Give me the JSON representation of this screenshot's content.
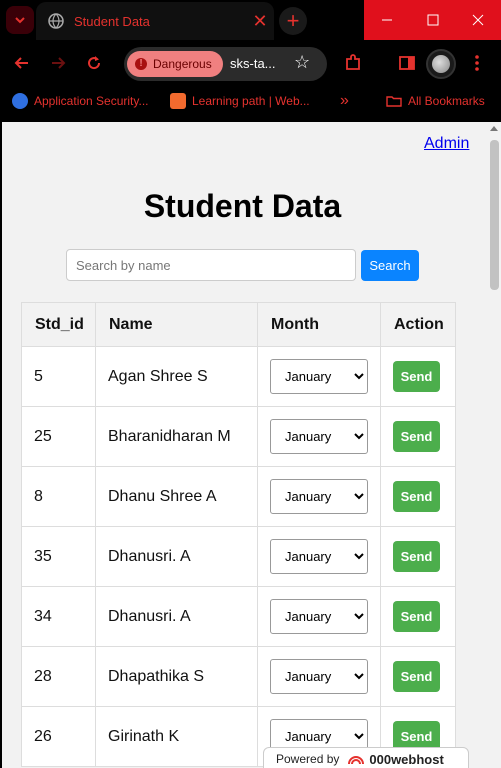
{
  "browser": {
    "tab_title": "Student Data",
    "security_label": "Dangerous",
    "url": "sks-ta...",
    "bookmarks": [
      {
        "label": "Application Security..."
      },
      {
        "label": "Learning path | Web..."
      },
      {
        "label": "All Bookmarks"
      }
    ],
    "overflow_label": "»",
    "colors": {
      "accent": "#e5322e",
      "window_controls": "#e0101c"
    }
  },
  "page": {
    "admin_link": "Admin",
    "title": "Student Data",
    "search": {
      "placeholder": "Search by name",
      "button_label": "Search"
    },
    "table": {
      "headers": [
        "Std_id",
        "Name",
        "Month",
        "Action"
      ],
      "rows": [
        {
          "id": "5",
          "name": "Agan Shree S",
          "month": "January",
          "action": "Send"
        },
        {
          "id": "25",
          "name": "Bharanidharan M",
          "month": "January",
          "action": "Send"
        },
        {
          "id": "8",
          "name": "Dhanu Shree A",
          "month": "January",
          "action": "Send"
        },
        {
          "id": "35",
          "name": "Dhanusri. A",
          "month": "January",
          "action": "Send"
        },
        {
          "id": "34",
          "name": "Dhanusri. A",
          "month": "January",
          "action": "Send"
        },
        {
          "id": "28",
          "name": "Dhapathika S",
          "month": "January",
          "action": "Send"
        },
        {
          "id": "26",
          "name": "Girinath K",
          "month": "January",
          "action": "Send"
        }
      ]
    },
    "footer": {
      "powered_by": "Powered by",
      "host_name": "000webhost"
    },
    "colors": {
      "search_button": "#0a84ff",
      "send_button": "#4cae4c"
    }
  }
}
